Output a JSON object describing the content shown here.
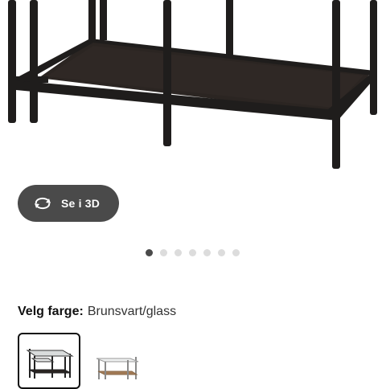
{
  "view_3d": {
    "label": "Se i 3D",
    "icon": "rotate-icon"
  },
  "carousel": {
    "count": 7,
    "active_index": 0
  },
  "color_picker": {
    "label": "Velg farge:",
    "selected_value": "Brunsvart/glass",
    "options": [
      {
        "name": "black-brown-glass",
        "selected": true
      },
      {
        "name": "oak-glass",
        "selected": false
      }
    ]
  },
  "colors": {
    "frame_dark": "#1f1d1c",
    "shelf_dark": "#2b2522",
    "button_bg": "#4a4a4a",
    "dot_active": "#4a4a4a",
    "dot_inactive": "#dcdcdc",
    "oak_shelf": "#a27a55"
  }
}
